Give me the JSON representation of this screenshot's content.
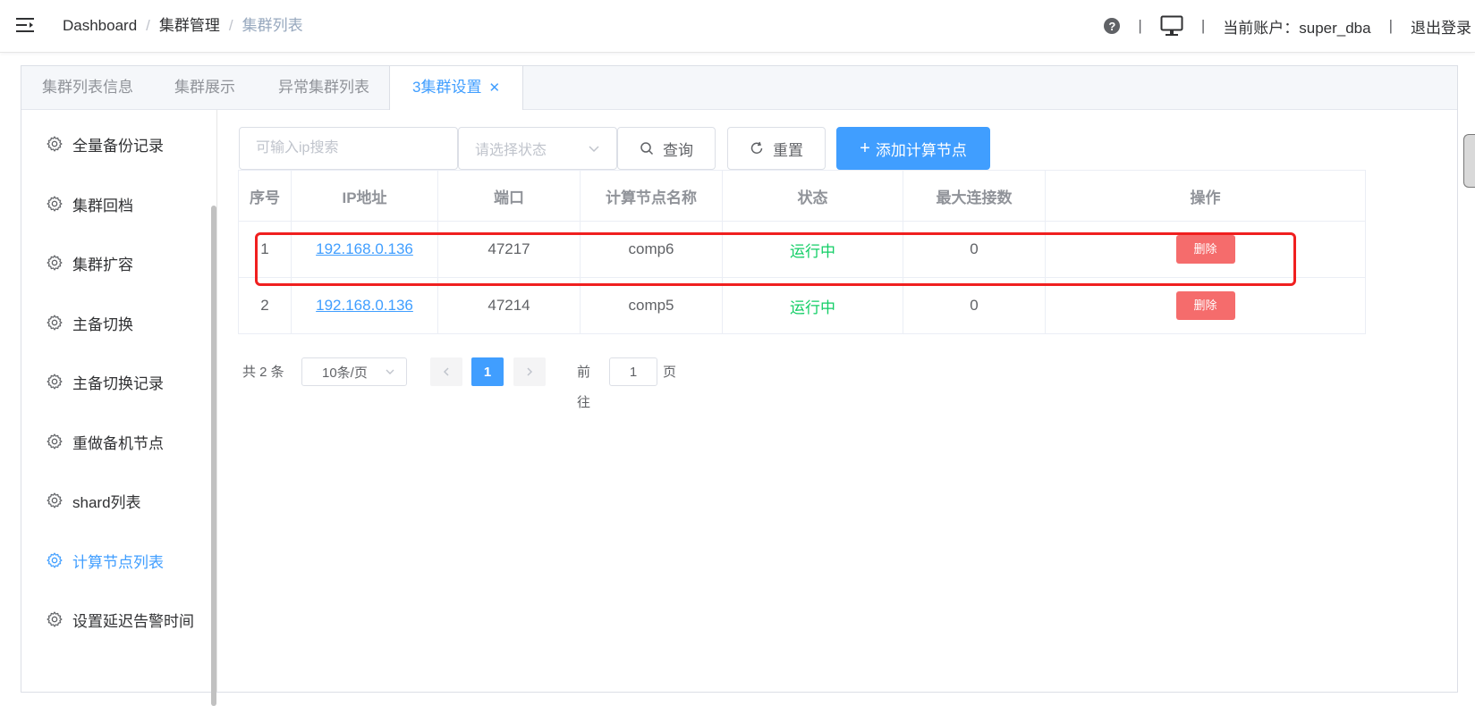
{
  "header": {
    "breadcrumb": [
      "Dashboard",
      "集群管理",
      "集群列表"
    ],
    "breadcrumb_separator": "/",
    "help_label": "?",
    "separator": "|",
    "account": "当前账户：super_dba",
    "logout": "退出登录"
  },
  "tabs": [
    {
      "label": "集群列表信息"
    },
    {
      "label": "集群展示"
    },
    {
      "label": "异常集群列表"
    },
    {
      "label": "3集群设置",
      "active": true,
      "closable": true
    }
  ],
  "tab_close_glyph": "✕",
  "side_menu": {
    "items": [
      {
        "label": "全量备份记录",
        "icon": "gear-icon"
      },
      {
        "label": "集群回档",
        "icon": "gear-icon"
      },
      {
        "label": "集群扩容",
        "icon": "gear-icon"
      },
      {
        "label": "主备切换",
        "icon": "gear-icon"
      },
      {
        "label": "主备切换记录",
        "icon": "gear-icon"
      },
      {
        "label": "重做备机节点",
        "icon": "gear-icon"
      },
      {
        "label": "shard列表",
        "icon": "gear-icon"
      },
      {
        "label": "计算节点列表",
        "icon": "gear-icon",
        "active": true
      },
      {
        "label": "设置延迟告警时间",
        "icon": "gear-icon"
      }
    ]
  },
  "toolbar": {
    "ip_placeholder": "可输入ip搜索",
    "status_placeholder": "请选择状态",
    "query_label": "查询",
    "reset_label": "重置",
    "add_label": "添加计算节点",
    "add_icon": "+"
  },
  "table": {
    "columns": [
      "序号",
      "IP地址",
      "端口",
      "计算节点名称",
      "状态",
      "最大连接数",
      "操作"
    ],
    "rows": [
      {
        "index": "1",
        "ip": "192.168.0.136",
        "port": "47217",
        "name": "comp6",
        "status": "运行中",
        "max_conn": "0",
        "action": "删除"
      },
      {
        "index": "2",
        "ip": "192.168.0.136",
        "port": "47214",
        "name": "comp5",
        "status": "运行中",
        "max_conn": "0",
        "action": "删除"
      }
    ]
  },
  "pagination": {
    "total": "共 2 条",
    "page_size": "10条/页",
    "current_page": "1",
    "goto_label": "前往",
    "goto_value": "1",
    "goto_suffix": "页"
  },
  "colors": {
    "primary": "#409eff",
    "danger": "#f56c6c",
    "success": "#13ce66",
    "highlight": "#f01f1f"
  }
}
